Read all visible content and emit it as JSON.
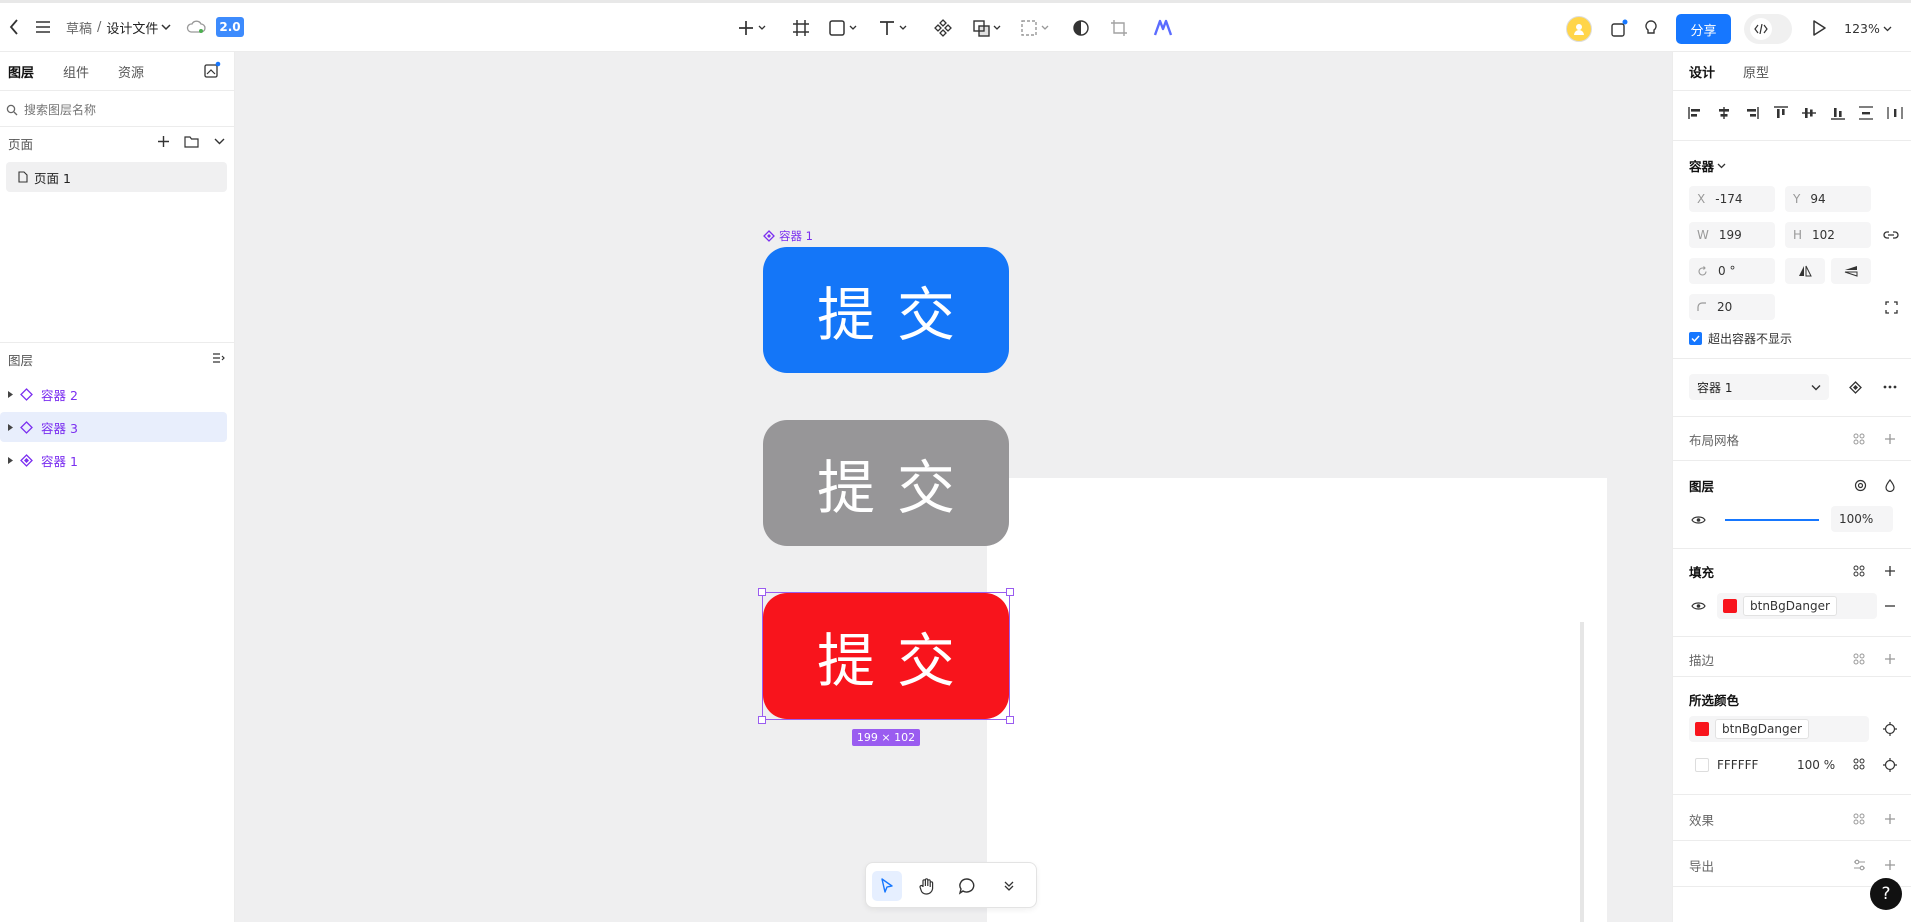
{
  "header": {
    "breadcrumb_root": "草稿",
    "separator": "/",
    "file_name": "设计文件",
    "version": "2.0",
    "share_label": "分享",
    "zoom": "123%",
    "colors": {
      "accent": "#1677ff"
    }
  },
  "left_panel": {
    "tabs": [
      "图层",
      "组件",
      "资源"
    ],
    "search_placeholder": "搜索图层名称",
    "pages_title": "页面",
    "pages": [
      "页面 1"
    ],
    "layers_title": "图层",
    "layers": [
      "容器 2",
      "容器 3",
      "容器 1"
    ]
  },
  "canvas": {
    "frame_label": "容器 1",
    "buttons": [
      {
        "text": "提交",
        "color": "#1476f8"
      },
      {
        "text": "提交",
        "color": "#979698"
      },
      {
        "text": "提交",
        "color": "#f8141c"
      }
    ],
    "size_badge": "199 × 102"
  },
  "right_panel": {
    "tabs": [
      "设计",
      "原型"
    ],
    "container_title": "容器",
    "x_label": "X",
    "x_value": "-174",
    "y_label": "Y",
    "y_value": "94",
    "w_label": "W",
    "w_value": "199",
    "h_label": "H",
    "h_value": "102",
    "rotation": "0 °",
    "radius": "20",
    "clip_label": "超出容器不显示",
    "component_name": "容器 1",
    "layout_grid": "布局网格",
    "layer_title": "图层",
    "opacity": "100%",
    "fill_title": "填充",
    "fill_token": "btnBgDanger",
    "fill_color": "#f8141c",
    "stroke_title": "描边",
    "selected_colors_title": "所选颜色",
    "selected_colors": [
      {
        "token": "btnBgDanger",
        "color": "#f8141c"
      },
      {
        "hex": "FFFFFF",
        "opacity": "100 %",
        "color": "#ffffff"
      }
    ],
    "effects_title": "效果",
    "export_title": "导出",
    "help": "?"
  }
}
